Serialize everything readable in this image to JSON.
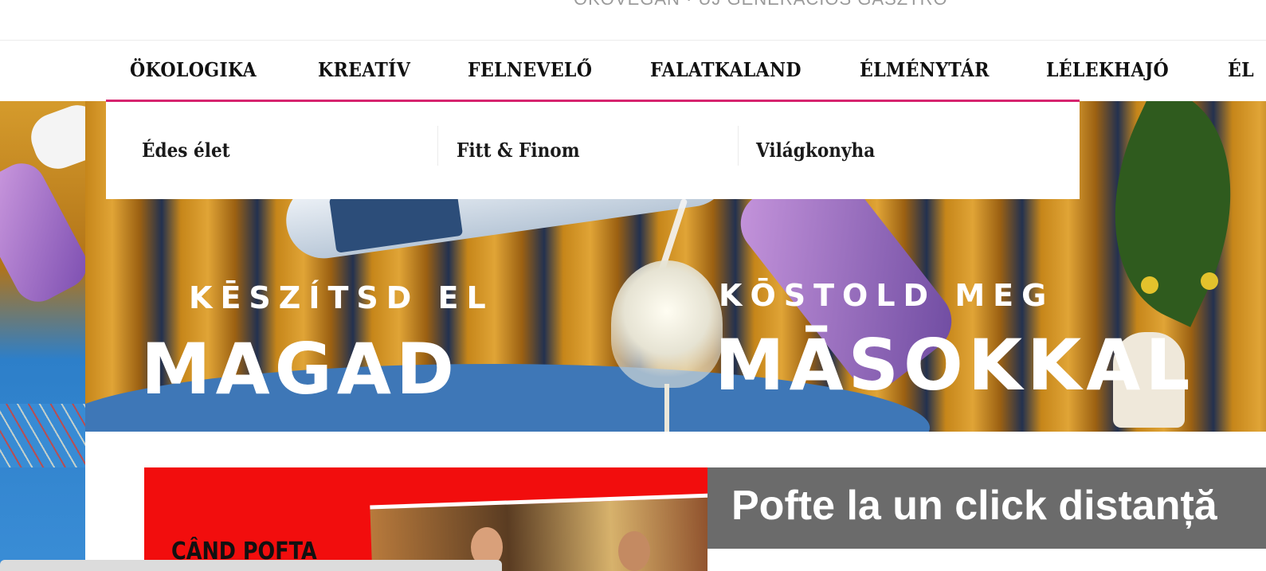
{
  "topbar": {
    "text": "ÖKOVEGÁN  ·  ÚJ GENERÁCIÓS GASZTRO"
  },
  "nav": {
    "items": [
      {
        "label": "ÖKOLOGIKA"
      },
      {
        "label": "KREATÍV"
      },
      {
        "label": "FELNEVELŐ"
      },
      {
        "label": "FALATKALAND"
      },
      {
        "label": "ÉLMÉNYTÁR"
      },
      {
        "label": "LÉLEKHAJÓ"
      },
      {
        "label": "ÉL"
      }
    ],
    "accent_color": "#d6246e"
  },
  "dropdown": {
    "items": [
      {
        "label": "Édes élet"
      },
      {
        "label": "Fitt & Finom"
      },
      {
        "label": "Világkonyha"
      }
    ]
  },
  "hero": {
    "left_small": "KĒSZÍTSD EL",
    "left_big": "MAGAD",
    "right_small": "KŌSTOLD MEG",
    "right_big": "MĀSOKKAL"
  },
  "promo": {
    "caption": "CÂND POFTA",
    "title": "Pofte la un click distanță",
    "title_bg": "#6b6b6b",
    "banner_bg": "#f20d0d"
  }
}
